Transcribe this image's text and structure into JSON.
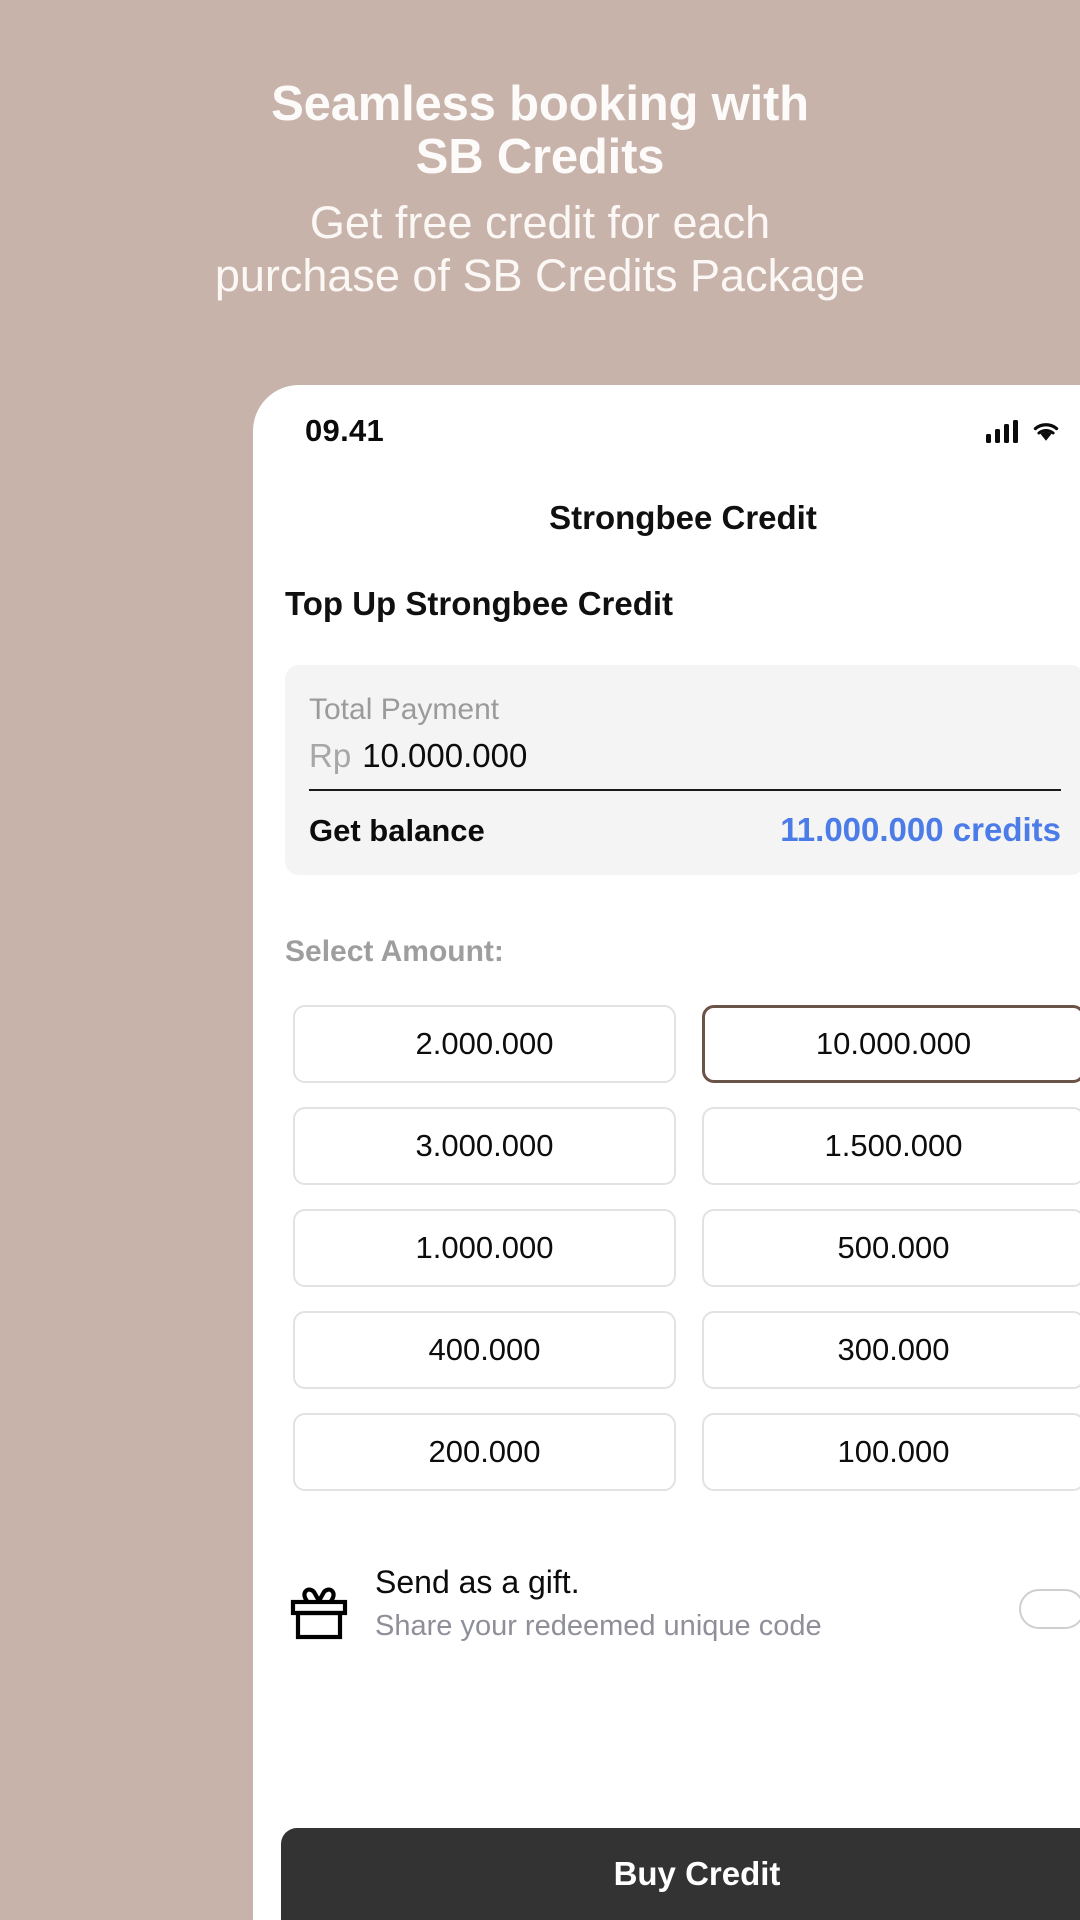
{
  "promo": {
    "headline_line1": "Seamless booking with",
    "headline_line2": "SB Credits",
    "subtitle_line1": "Get free credit for each",
    "subtitle_line2": "purchase of SB Credits Package",
    "background_color": "#C8B3AB",
    "text_color": "#FFFFFF"
  },
  "statusbar": {
    "time": "09.41",
    "signal_icon": "cellular-signal-icon",
    "wifi_icon": "wifi-icon"
  },
  "header": {
    "title": "Strongbee Credit"
  },
  "main": {
    "section_title": "Top Up Strongbee Credit",
    "payment_card": {
      "label": "Total Payment",
      "currency": "Rp",
      "amount": "10.000.000",
      "balance_label": "Get balance",
      "balance_value": "11.000.000 credits",
      "balance_color": "#4B7CE8"
    },
    "select_amount_label": "Select Amount:",
    "selected_amount": "10.000.000",
    "selected_border_color": "#6A5347",
    "amounts": [
      "2.000.000",
      "10.000.000",
      "3.000.000",
      "1.500.000",
      "1.000.000",
      "500.000",
      "400.000",
      "300.000",
      "200.000",
      "100.000"
    ],
    "gift": {
      "icon": "gift-icon",
      "title": "Send as a gift.",
      "subtitle": "Share your redeemed unique code",
      "toggle_state": "off"
    }
  },
  "footer": {
    "buy_label": "Buy Credit",
    "buy_color": "#333333"
  }
}
